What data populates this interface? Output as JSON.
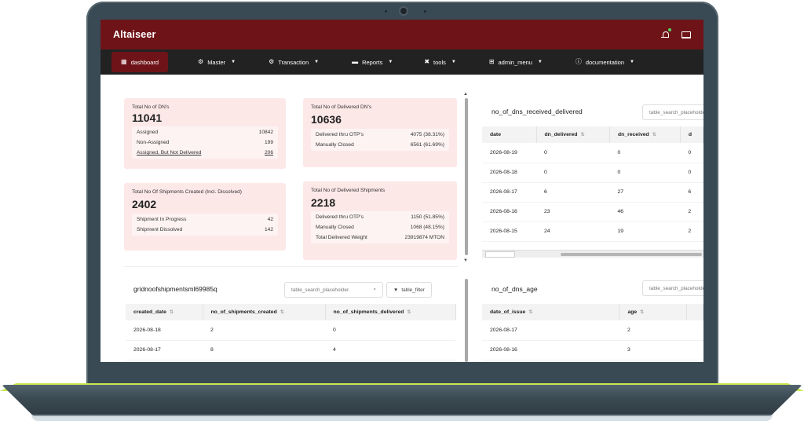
{
  "app": {
    "title": "Altaiseer"
  },
  "nav": {
    "items": [
      {
        "label": "dashboard",
        "icon": "dashboard-icon"
      },
      {
        "label": "Master",
        "icon": "gear-icon"
      },
      {
        "label": "Transaction",
        "icon": "gear-icon"
      },
      {
        "label": "Reports",
        "icon": "folder-icon"
      },
      {
        "label": "tools",
        "icon": "tools-icon"
      },
      {
        "label": "admin_menu",
        "icon": "sitemap-icon"
      },
      {
        "label": "documentation",
        "icon": "info-icon"
      }
    ]
  },
  "cards": {
    "total_dn": {
      "title": "Total No of DN's",
      "value": "11041",
      "rows": [
        {
          "label": "Assigned",
          "value": "10842"
        },
        {
          "label": "Non-Assigned",
          "value": "199"
        },
        {
          "label": "Assigned, But Not Delivered",
          "value": "206"
        }
      ]
    },
    "delivered_dn": {
      "title": "Total No of Delivered DN's",
      "value": "10636",
      "rows": [
        {
          "label": "Delivered thru OTP's",
          "value": "4075 (38.31%)"
        },
        {
          "label": "Manually Closed",
          "value": "6561 (61.69%)"
        }
      ]
    },
    "shipments_created": {
      "title": "Total No Of Shipments Created (Incl. Dissolved)",
      "value": "2402",
      "rows": [
        {
          "label": "Shipment In Progress",
          "value": "42"
        },
        {
          "label": "Shipment Dissolved",
          "value": "142"
        }
      ]
    },
    "delivered_shipments": {
      "title": "Total No of Delivered Shipments",
      "value": "2218",
      "rows": [
        {
          "label": "Delivered thru OTP's",
          "value": "1150 (51.85%)"
        },
        {
          "label": "Manually Closed",
          "value": "1068 (48.15%)"
        },
        {
          "label": "Total Delivered Weight",
          "value": "23919874 MTON"
        }
      ]
    }
  },
  "dns_received_delivered": {
    "title": "no_of_dns_received_delivered",
    "search_placeholder": "table_search_placeholder",
    "columns": [
      "date",
      "dn_delivered",
      "dn_received",
      "d"
    ],
    "rows": [
      [
        "2026-08-19",
        "0",
        "0",
        "0"
      ],
      [
        "2026-08-18",
        "0",
        "0",
        "0"
      ],
      [
        "2026-08-17",
        "6",
        "27",
        "6"
      ],
      [
        "2026-08-16",
        "23",
        "46",
        "2"
      ],
      [
        "2026-08-15",
        "24",
        "19",
        "2"
      ]
    ]
  },
  "shipments_grid": {
    "title": "gridnoofshipmentsml69985q",
    "search_placeholder": "table_search_placeholder.",
    "filter_label": "table_filter",
    "columns": [
      "created_date",
      "no_of_shipments_created",
      "no_of_shipments_delivered"
    ],
    "rows": [
      [
        "2026-08-18",
        "2",
        "0"
      ],
      [
        "2026-08-17",
        "8",
        "4"
      ]
    ]
  },
  "dns_age": {
    "title": "no_of_dns_age",
    "search_placeholder": "table_search_placeholder",
    "columns": [
      "date_of_issue",
      "age"
    ],
    "rows": [
      [
        "2026-08-17",
        "2"
      ],
      [
        "2026-08-16",
        "3"
      ]
    ]
  },
  "colors": {
    "brand": "#6e1418",
    "nav_bg": "#222222",
    "card_bg": "#fde8e8",
    "screen_bezel": "#3a4a55",
    "laptop_lip": "#c9e84e"
  }
}
